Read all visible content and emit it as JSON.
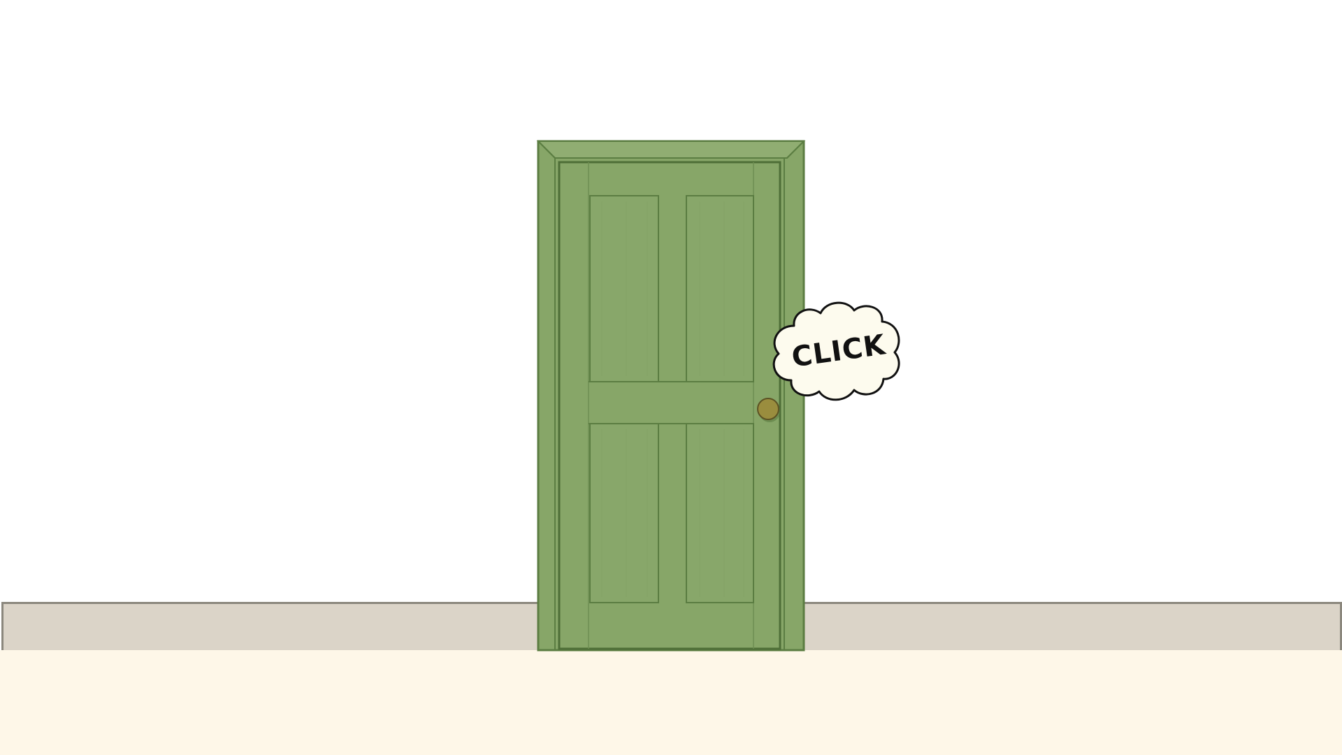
{
  "scene": {
    "name": "door-room",
    "colors": {
      "wall": "#ffffff",
      "baseboard": "#dbd4c8",
      "baseboard_border": "#8b877d",
      "floor": "#fef7e8",
      "door": "#87a668",
      "door_dark": "#5b7d42",
      "knob": "#9a8d3e",
      "bubble": "#fdfbee"
    }
  },
  "door": {
    "icon": "door-icon",
    "knob_icon": "doorknob-icon"
  },
  "click_bubble": {
    "label": "CLICK",
    "icon": "cloud-bubble-icon"
  }
}
